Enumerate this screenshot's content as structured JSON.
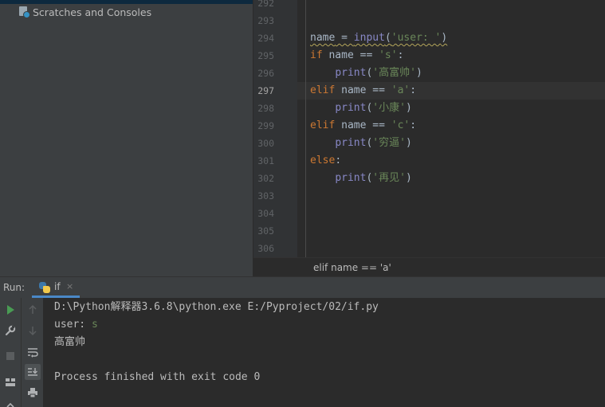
{
  "project_panel": {
    "scratches_label": "Scratches and Consoles"
  },
  "editor": {
    "line_numbers": [
      "292",
      "293",
      "294",
      "295",
      "296",
      "297",
      "298",
      "299",
      "300",
      "301",
      "302",
      "303",
      "304",
      "305",
      "306"
    ],
    "current_line": "297",
    "lines": {
      "l294": {
        "var": "name",
        "eq": " = ",
        "fn": "input",
        "open": "(",
        "str": "'user: '",
        "close": ")"
      },
      "l295": {
        "kw": "if",
        "rest": " name == ",
        "str": "'s'",
        "colon": ":"
      },
      "l296": {
        "indent": "    ",
        "fn": "print",
        "open": "(",
        "str": "'高富帅'",
        "close": ")"
      },
      "l297": {
        "kw": "elif",
        "rest": " name == ",
        "str": "'a'",
        "colon": ":"
      },
      "l298": {
        "indent": "    ",
        "fn": "print",
        "open": "(",
        "str": "'小康'",
        "close": ")"
      },
      "l299": {
        "kw": "elif",
        "rest": " name == ",
        "str": "'c'",
        "colon": ":"
      },
      "l300": {
        "indent": "    ",
        "fn": "print",
        "open": "(",
        "str": "'穷逼'",
        "close": ")"
      },
      "l301": {
        "kw": "else",
        "colon": ":"
      },
      "l302": {
        "indent": "    ",
        "fn": "print",
        "open": "(",
        "str": "'再见'",
        "close": ")"
      }
    },
    "breadcrumb": "elif name == 'a'"
  },
  "run_window": {
    "title": "Run:",
    "tab_label": "if",
    "tab_close": "×",
    "console": {
      "command": "D:\\Python解释器3.6.8\\python.exe E:/Pyproject/02/if.py",
      "prompt": "user: ",
      "input": "s",
      "output": "高富帅",
      "finished": "Process finished with exit code 0"
    }
  },
  "icons": {
    "run": "run-icon",
    "wrench": "wrench-icon",
    "stop": "stop-icon",
    "layout": "layout-icon",
    "up": "arrow-up-icon",
    "down": "arrow-down-icon",
    "soft_wrap": "soft-wrap-icon",
    "scroll_to_end": "scroll-to-end-icon",
    "print": "print-icon"
  },
  "colors": {
    "keyword": "#cc7832",
    "string": "#6a8759",
    "builtin": "#8888c6",
    "run_green": "#499c54"
  }
}
